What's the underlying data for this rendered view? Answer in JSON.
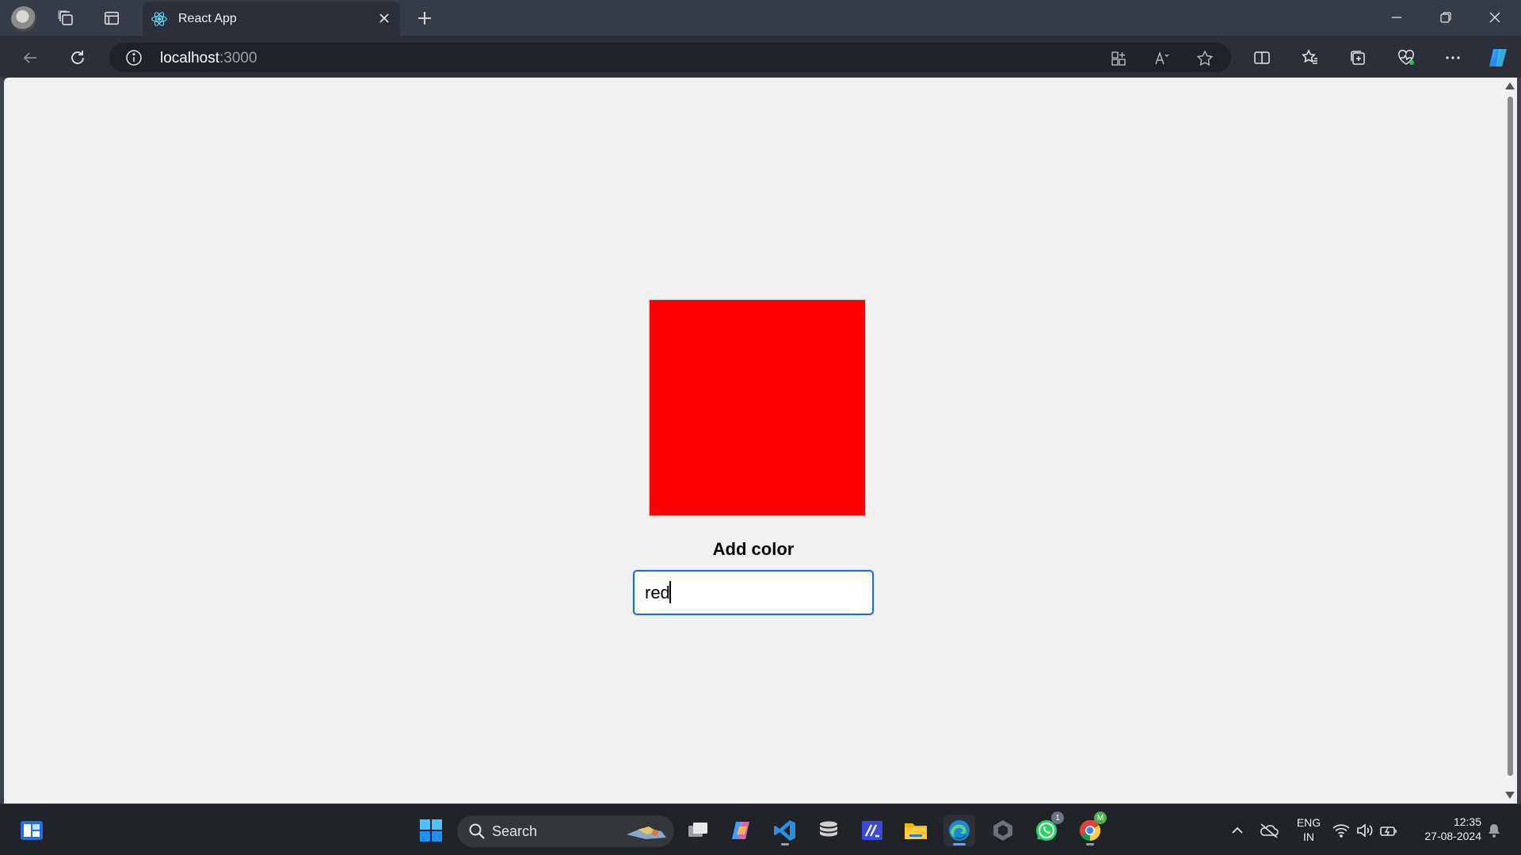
{
  "browser": {
    "tab": {
      "title": "React App"
    },
    "address": {
      "host": "localhost",
      "port": ":3000"
    }
  },
  "page": {
    "box_color": "#ff0000",
    "label": "Add color",
    "input_value": "red"
  },
  "taskbar": {
    "search_label": "Search",
    "whatsapp_badge": "1",
    "chrome_badge": "M",
    "language_line1": "ENG",
    "language_line2": "IN",
    "time": "12:35",
    "date": "27-08-2024"
  },
  "colors": {
    "accent": "#1a6fd9",
    "titlebar": "#353b47",
    "toolbar": "#2b2f37",
    "taskbar": "#202327"
  }
}
